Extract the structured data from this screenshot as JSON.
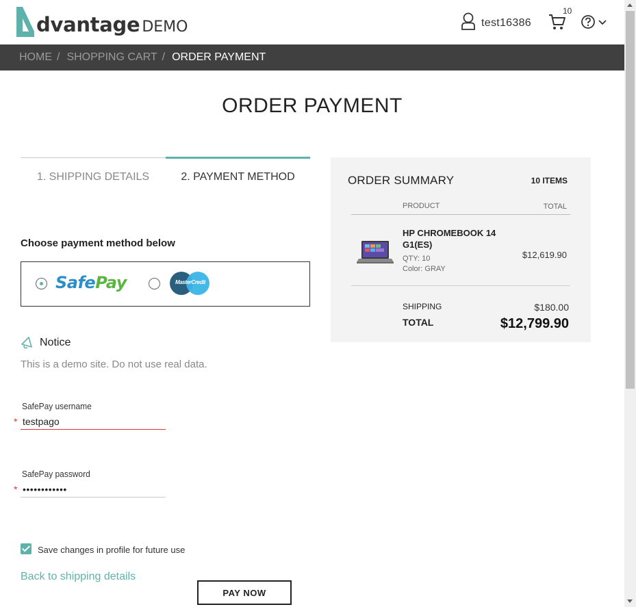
{
  "header": {
    "logo_word": "dvantage",
    "logo_demo": "DEMO",
    "username": "test16386",
    "cart_count": "10"
  },
  "breadcrumb": {
    "home": "HOME",
    "cart": "SHOPPING CART",
    "current": "ORDER PAYMENT",
    "sep": "/"
  },
  "page_title": "ORDER PAYMENT",
  "steps": {
    "step1": "1. SHIPPING DETAILS",
    "step2": "2. PAYMENT METHOD"
  },
  "payment": {
    "choose_label": "Choose payment method below",
    "safepay_a": "Safe",
    "safepay_b": "Pay",
    "mastercredit": "MasterCredit"
  },
  "notice": {
    "title": "Notice",
    "text": "This is a demo site. Do not use real data."
  },
  "form": {
    "username_label": "SafePay username",
    "username_value": "testpago",
    "password_label": "SafePay password",
    "password_value": "••••••••••••",
    "required_mark": "*",
    "save_label": "Save changes in profile for future use",
    "back_link": "Back to shipping details",
    "pay_button": "PAY NOW"
  },
  "summary": {
    "title": "ORDER SUMMARY",
    "items": "10 ITEMS",
    "col_product": "PRODUCT",
    "col_total": "TOTAL",
    "product_name": "HP CHROMEBOOK 14 G1(ES)",
    "qty": "QTY: 10",
    "color": "Color: GRAY",
    "price": "$12,619.90",
    "shipping_label": "SHIPPING",
    "shipping_value": "$180.00",
    "total_label": "TOTAL",
    "total_value": "$12,799.90"
  },
  "colors": {
    "accent": "#5fb2ab",
    "breadcrumb_bg": "#404040",
    "error": "#e03131"
  }
}
